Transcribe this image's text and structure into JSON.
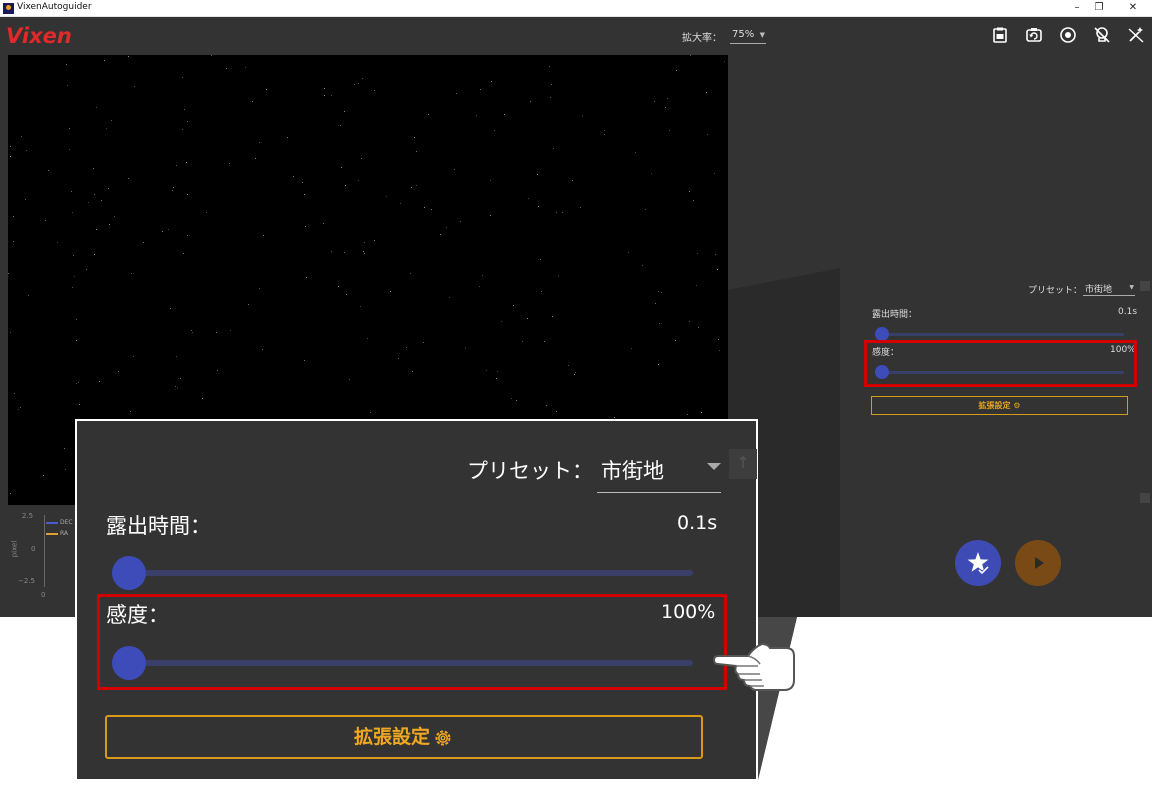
{
  "window": {
    "title": "VixenAutoguider",
    "minimize_glyph": "–",
    "restore_glyph": "❐",
    "close_glyph": "✕"
  },
  "header": {
    "logo": "Vixen",
    "zoom_label": "拡大率：",
    "zoom_value": "75%",
    "icons": [
      "clipboard-icon",
      "camera-rotate-icon",
      "target-icon",
      "guide-star-off-icon",
      "magic-wand-off-icon"
    ]
  },
  "graph": {
    "y_ticks": [
      "2.5",
      "0",
      "−2.5"
    ],
    "x_tick": "0",
    "ylabel": "pixel",
    "legend": [
      {
        "name": "DEC",
        "color": "#4a5ad0"
      },
      {
        "name": "RA",
        "color": "#e0a030"
      }
    ]
  },
  "panel": {
    "preset_label": "プリセット：",
    "preset_value": "市街地",
    "exposure_label": "露出時間：",
    "exposure_value": "0.1s",
    "exposure_level": 0,
    "sensitivity_label": "感度：",
    "sensitivity_value": "100%",
    "sensitivity_level": 0,
    "advanced_button": "拡張設定"
  },
  "zoomed_panel": {
    "preset_label": "プリセット：",
    "preset_value": "市街地",
    "scroll_up": "↑",
    "exposure_label": "露出時間：",
    "exposure_value": "0.1s",
    "sensitivity_label": "感度：",
    "sensitivity_value": "100%",
    "advanced_button": "拡張設定"
  },
  "colors": {
    "background": "#333333",
    "accent_blue": "#3d4cb8",
    "accent_orange": "#d99a1a",
    "highlight_red": "#d40000",
    "logo_red": "#e3282a"
  }
}
